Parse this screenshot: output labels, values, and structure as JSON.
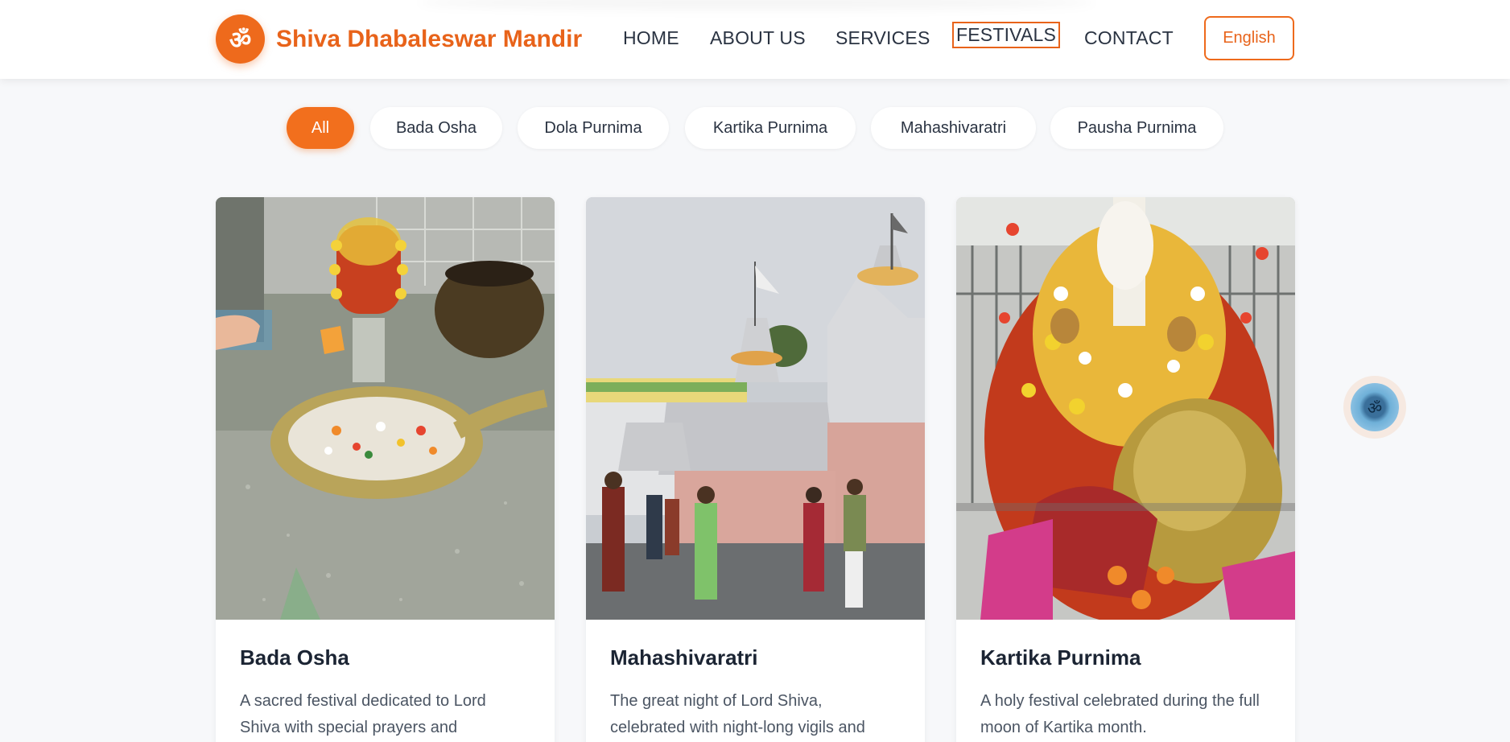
{
  "header": {
    "logo_glyph": "ॐ",
    "site_title": "Shiva Dhabaleswar Mandir",
    "nav": [
      {
        "label": "HOME"
      },
      {
        "label": "ABOUT US"
      },
      {
        "label": "SERVICES"
      },
      {
        "label": "FESTIVALS",
        "active": true
      },
      {
        "label": "CONTACT"
      }
    ],
    "language_button": "English"
  },
  "filters": {
    "chips": [
      {
        "label": "All",
        "active": true
      },
      {
        "label": "Bada Osha"
      },
      {
        "label": "Dola Purnima"
      },
      {
        "label": "Kartika Purnima"
      },
      {
        "label": "Mahashivaratri"
      },
      {
        "label": "Pausha Purnima"
      }
    ]
  },
  "cards": [
    {
      "title": "Bada Osha",
      "description": "A sacred festival dedicated to Lord Shiva with special prayers and",
      "image_label": "shiva-lingam-flower-offering-photo"
    },
    {
      "title": "Mahashivaratri",
      "description": "The great night of Lord Shiva, celebrated with night-long vigils and",
      "image_label": "temple-exterior-devotees-photo"
    },
    {
      "title": "Kartika Purnima",
      "description": "A holy festival celebrated during the full moon of Kartika month.",
      "image_label": "decorated-deity-flowers-photo"
    }
  ],
  "floating_button": {
    "glyph": "ॐ"
  },
  "colors": {
    "brand_orange": "#ee6a1c",
    "text_dark": "#1b2433",
    "background": "#f7f8fa"
  }
}
